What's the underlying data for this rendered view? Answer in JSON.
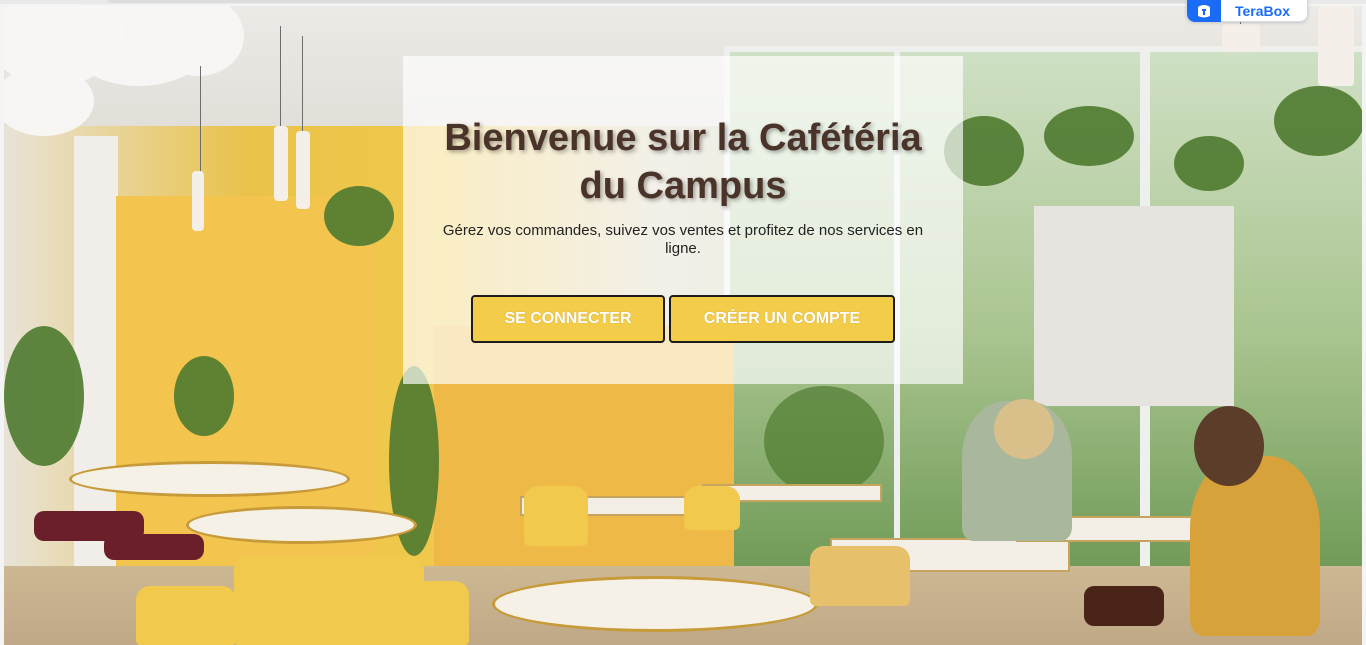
{
  "hero": {
    "title": "Bienvenue sur la Cafétéria du Campus",
    "subtitle": "Gérez vos commandes, suivez vos ventes et profitez de nos services en ligne.",
    "background_image": "cafe-interior-photo"
  },
  "actions": {
    "login_label": "SE CONNECTER",
    "signup_label": "CRÉER UN COMPTE"
  },
  "terabox": {
    "label": "TeraBox",
    "icon": "terabox-icon"
  },
  "colors": {
    "title": "#4a3328",
    "button_bg": "#f3cc4a",
    "button_border": "#1c1c1c",
    "button_text": "#ffffff",
    "terabox_blue": "#1a6cf6"
  }
}
